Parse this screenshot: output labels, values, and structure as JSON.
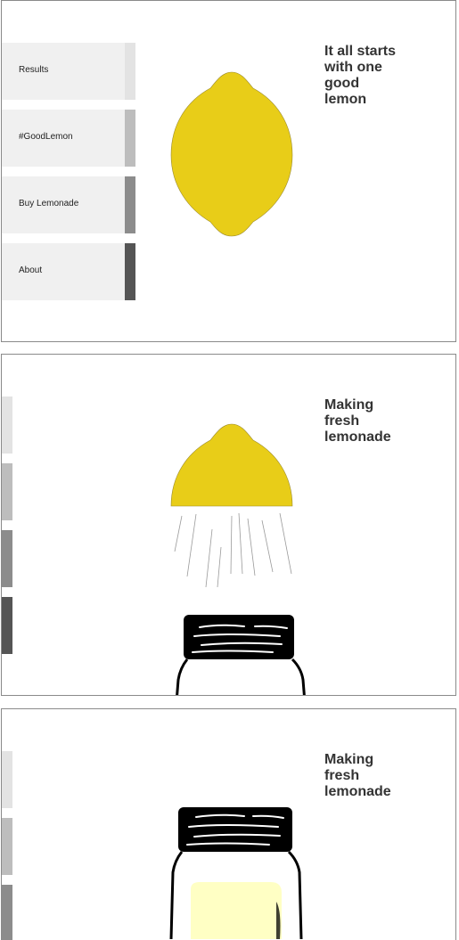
{
  "scene1": {
    "heading_lines": [
      "It all starts",
      "with one",
      "good",
      "lemon"
    ],
    "menu": [
      {
        "label": "Results",
        "tab_color": "#e3e3e3"
      },
      {
        "label": "#GoodLemon",
        "tab_color": "#bdbdbd"
      },
      {
        "label": "Buy Lemonade",
        "tab_color": "#8c8c8c"
      },
      {
        "label": "About",
        "tab_color": "#555555"
      }
    ]
  },
  "scene2": {
    "heading_lines": [
      "Making",
      "fresh",
      "lemonade"
    ]
  },
  "scene3": {
    "heading_lines": [
      "Making",
      "fresh",
      "lemonade"
    ]
  },
  "colors": {
    "lemon": "#e8cd18",
    "lemonade": "#ffffc4",
    "tab_1": "#e3e3e3",
    "tab_2": "#bdbdbd",
    "tab_3": "#8c8c8c",
    "tab_4": "#555555"
  },
  "icons": [
    "lemon-icon",
    "half-lemon-icon",
    "juice-drops-icon",
    "mason-jar-icon"
  ]
}
